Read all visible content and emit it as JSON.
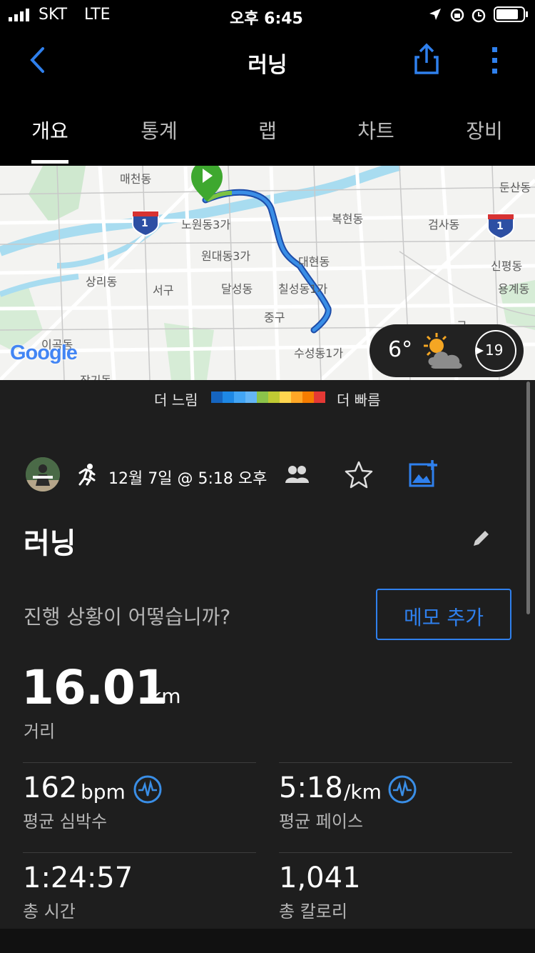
{
  "status": {
    "carrier": "SKT",
    "network": "LTE",
    "time": "오후 6:45"
  },
  "nav": {
    "title": "러닝",
    "back_icon": "chevron-left-icon",
    "share_icon": "share-icon",
    "more_icon": "more-vertical-icon"
  },
  "tabs": [
    "개요",
    "통계",
    "랩",
    "차트",
    "장비"
  ],
  "map": {
    "labels": [
      "매천동",
      "노원동3가",
      "원대동3가",
      "복현동",
      "검사동",
      "둔산동",
      "상리동",
      "서구",
      "달성동",
      "대현동",
      "칠성동1가",
      "신평동",
      "용계동",
      "중구",
      "수성동1가",
      "이곡동",
      "장기동",
      "구",
      "1",
      "1"
    ],
    "google": "Google",
    "weather": {
      "temp": "6°",
      "wind": "19"
    }
  },
  "legend": {
    "slow": "더 느림",
    "fast": "더 빠름",
    "colors": [
      "#1565c0",
      "#1e88e5",
      "#42a5f5",
      "#64b5f6",
      "#8bc34a",
      "#c0ca33",
      "#ffd54f",
      "#ffa726",
      "#f57c00",
      "#e53935"
    ]
  },
  "activity": {
    "date": "12월 7일 @ 5:18 오후",
    "title": "러닝",
    "prompt": "진행 상황이 어떻습니까?",
    "memo_button": "메모 추가"
  },
  "stats": {
    "distance": {
      "value": "16.01",
      "unit": "km",
      "label": "거리"
    },
    "heart_rate": {
      "value": "162",
      "unit": "bpm",
      "label": "평균 심박수"
    },
    "pace": {
      "value": "5:18",
      "unit": "/km",
      "label": "평균 페이스"
    },
    "time": {
      "value": "1:24:57",
      "label": "총 시간"
    },
    "calories": {
      "value": "1,041",
      "label": "총 칼로리"
    }
  },
  "colors": {
    "accent": "#2f80ed",
    "background": "#1e1e1e"
  }
}
